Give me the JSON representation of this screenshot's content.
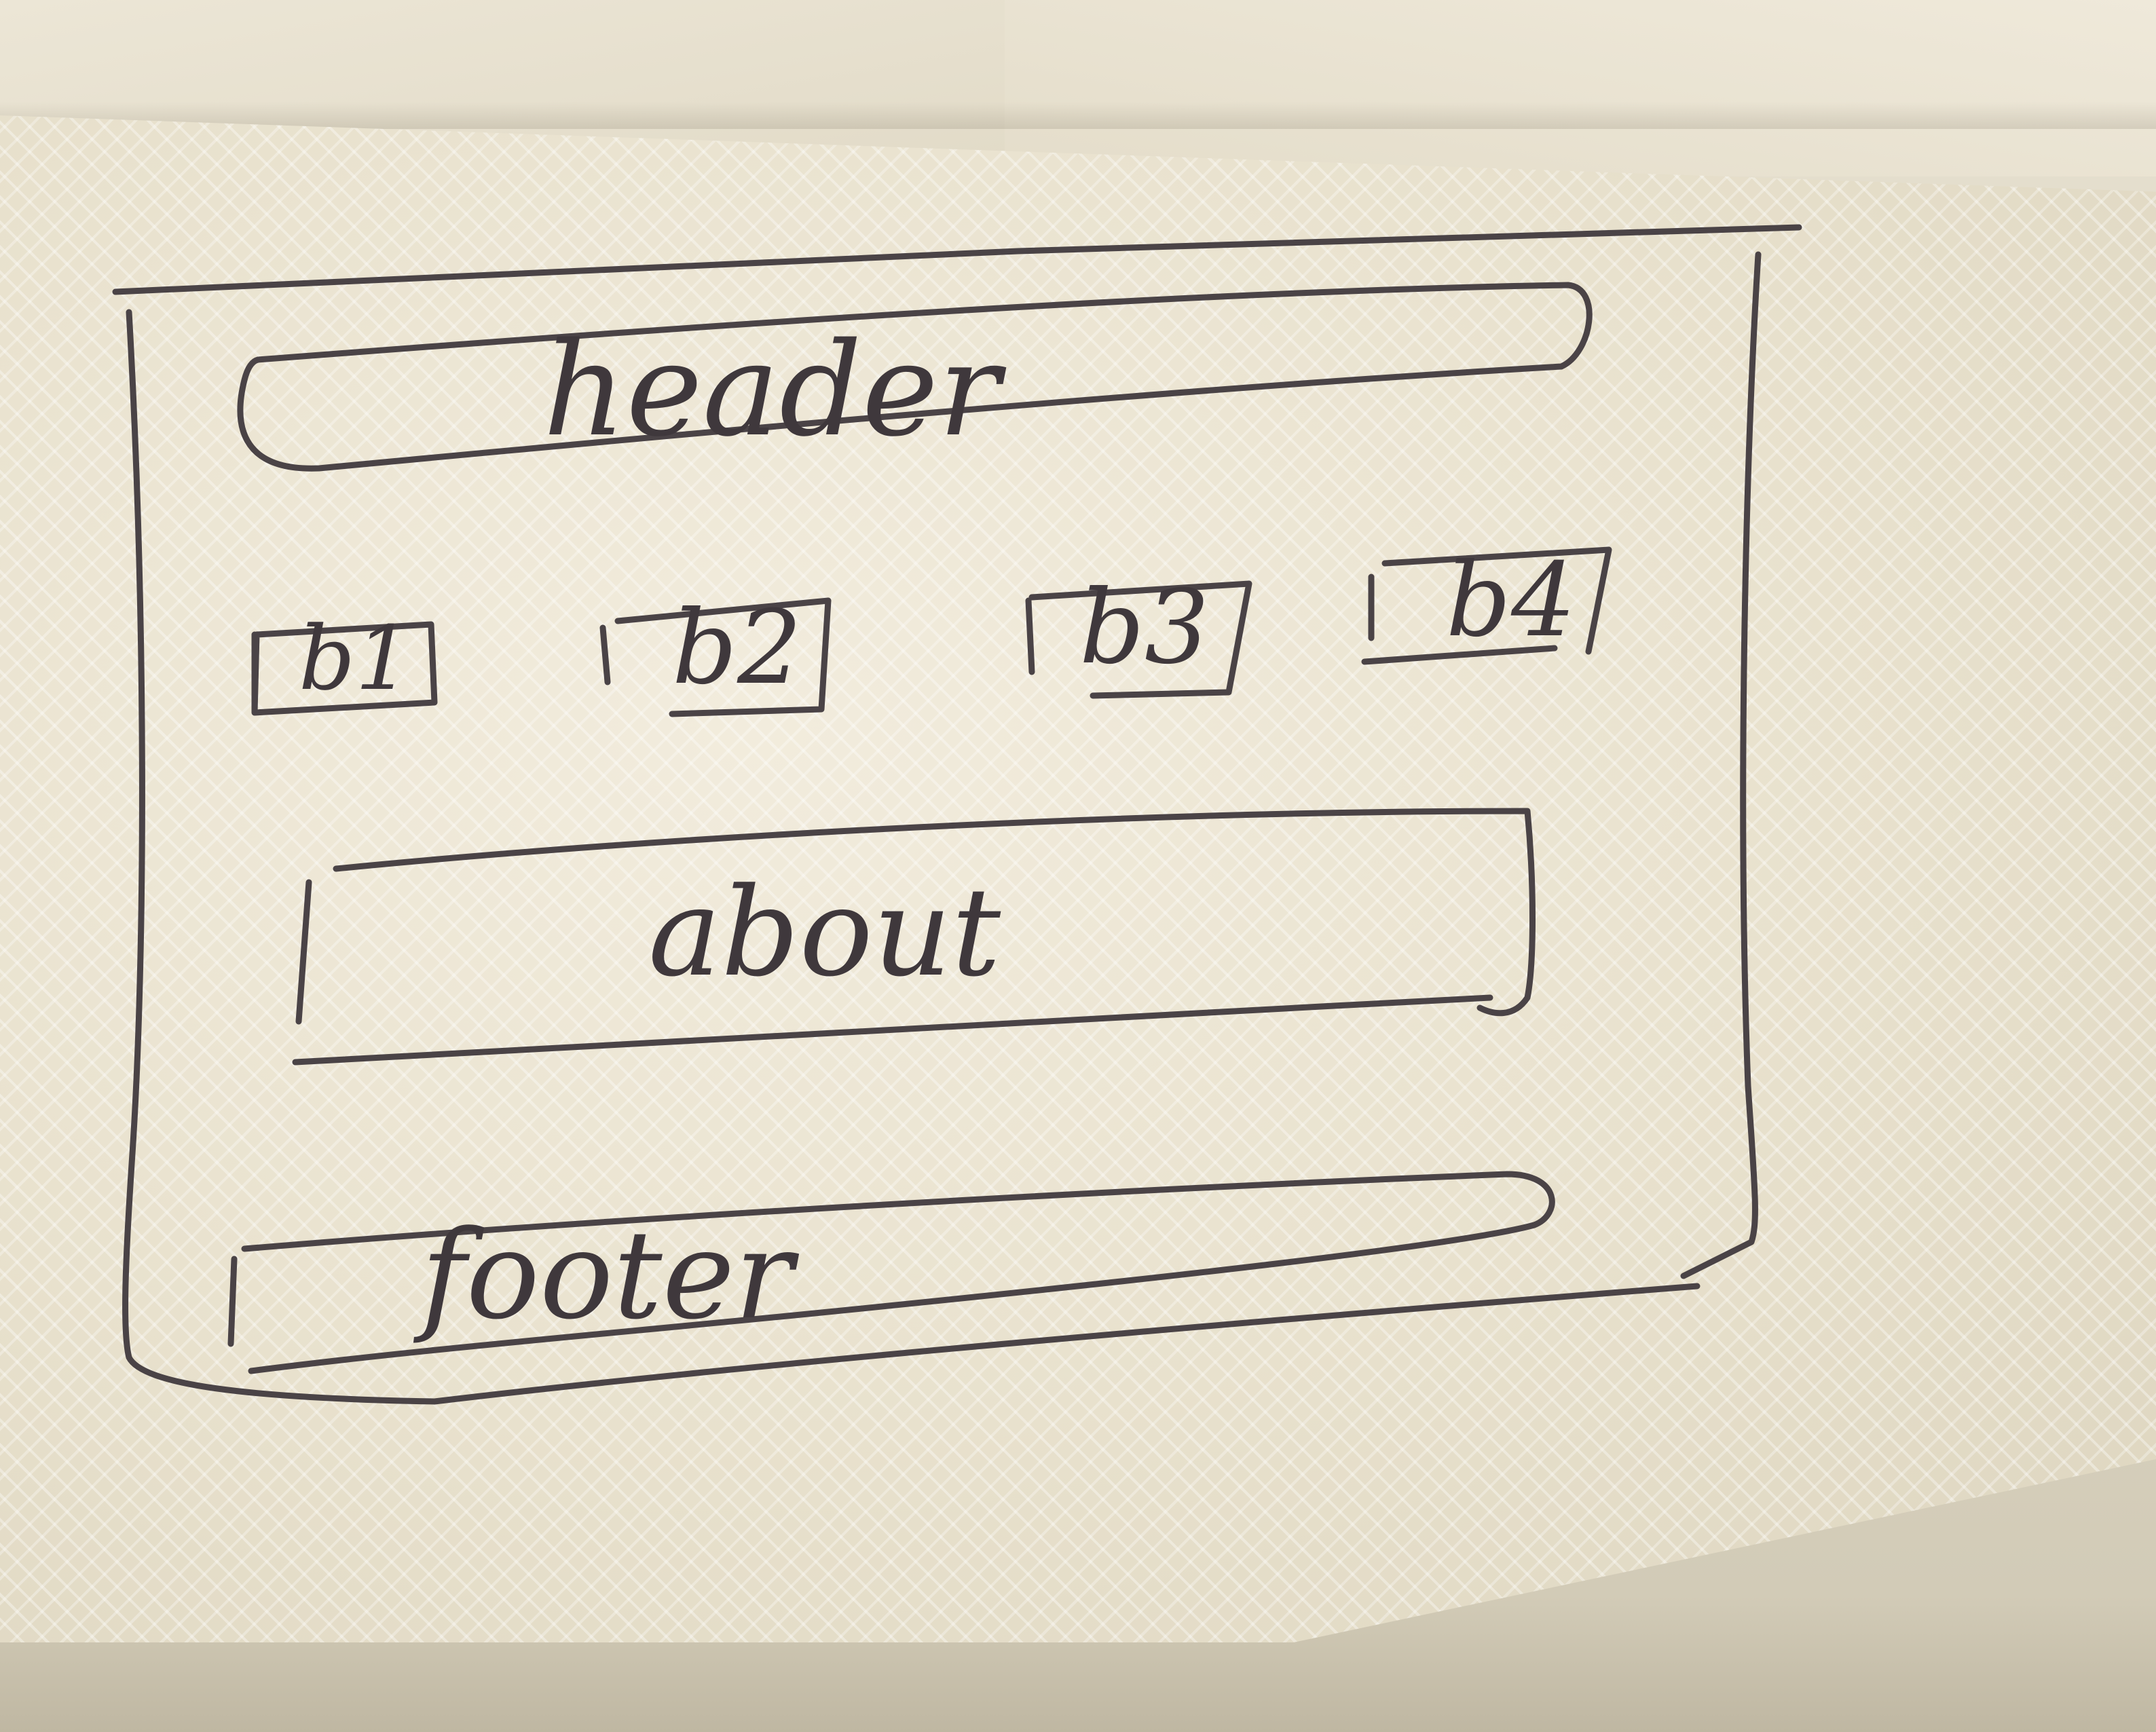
{
  "sketch": {
    "header": "header",
    "buttons": [
      "b1",
      "b2",
      "b3",
      "b4"
    ],
    "about": "about",
    "footer": "footer"
  }
}
